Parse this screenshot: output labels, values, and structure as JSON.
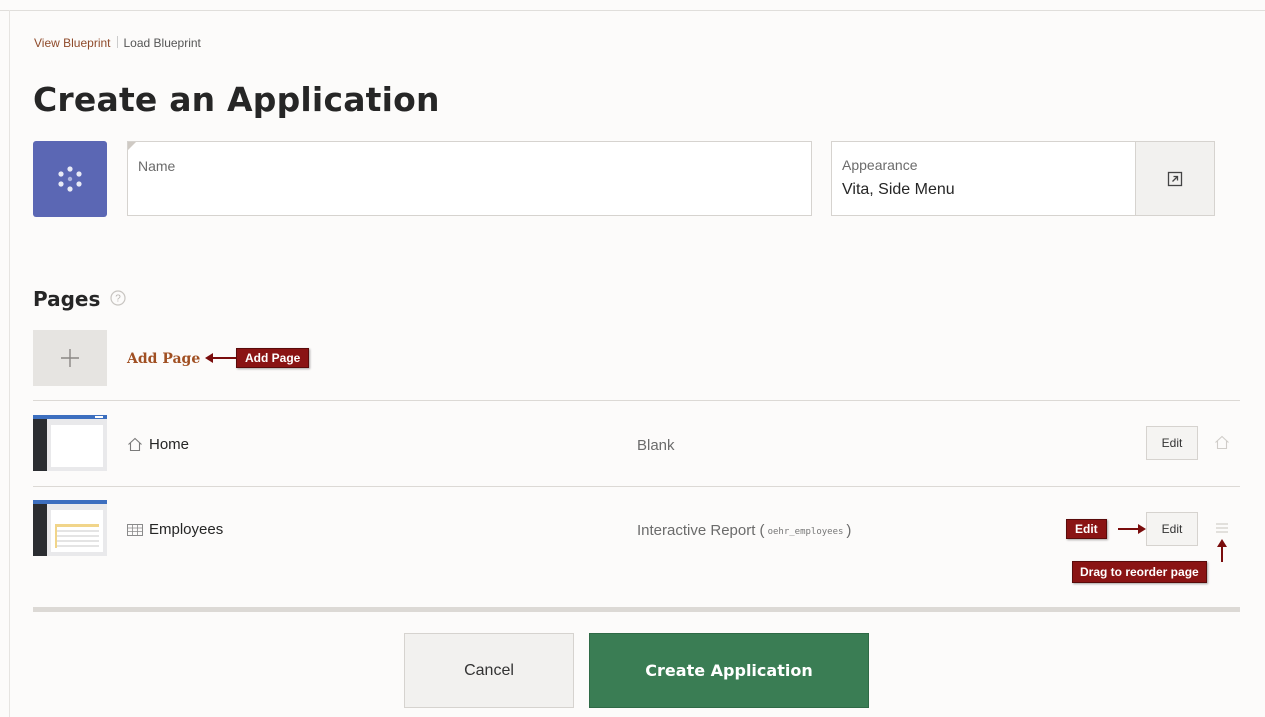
{
  "breadcrumbs": {
    "view_blueprint": "View Blueprint",
    "load_blueprint": "Load Blueprint"
  },
  "page_title": "Create an Application",
  "name_field": {
    "label": "Name",
    "value": "",
    "placeholder": ""
  },
  "appearance": {
    "label": "Appearance",
    "value": "Vita, Side Menu"
  },
  "pages": {
    "heading": "Pages",
    "add_link": "Add Page",
    "rows": [
      {
        "name": "Home",
        "type": "Blank",
        "source": "",
        "edit_label": "Edit",
        "icon": "home-icon"
      },
      {
        "name": "Employees",
        "type": "Interactive Report (",
        "source": "oehr_employees",
        "type_suffix": ")",
        "edit_label": "Edit",
        "icon": "table-icon"
      }
    ]
  },
  "callouts": {
    "add_page": "Add Page",
    "edit": "Edit",
    "drag": "Drag to reorder page"
  },
  "footer": {
    "cancel_label": "Cancel",
    "create_label": "Create Application"
  },
  "colors": {
    "accent_link": "#a04f22",
    "app_icon_bg": "#5b67b4",
    "primary_button": "#3a7d54",
    "callout_bg": "#8a1414"
  }
}
